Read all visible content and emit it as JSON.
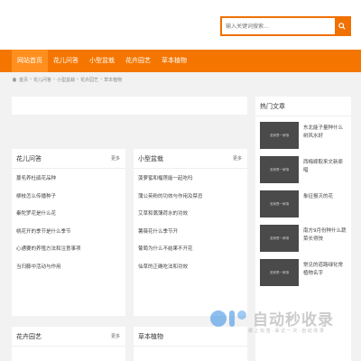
{
  "search": {
    "placeholder": "输入关键词搜索..."
  },
  "nav": {
    "items": [
      {
        "label": "网站首页"
      },
      {
        "label": "花儿问答"
      },
      {
        "label": "小型盆栽"
      },
      {
        "label": "花卉园艺"
      },
      {
        "label": "草本植物"
      }
    ]
  },
  "breadcrumb": {
    "home": "首页",
    "sep": "›",
    "c1": "花儿问答",
    "c2": "小型盆栽",
    "c3": "花卉园艺",
    "c4": "草本植物"
  },
  "panels": [
    {
      "title": "花儿问答",
      "more": "更多",
      "items": [
        "蔓毛养杜鹃花品种",
        "柳枝怎么传播种子",
        "秦陀罗花是什么花",
        "桃花开的季节是什么季节",
        "心通要的养殖方法和注意事项",
        "当归藤中活动与作用"
      ]
    },
    {
      "title": "小型盆栽",
      "more": "更多",
      "items": [
        "菠萝蜜和榴莲能一起吃吗",
        "蒲公英粉的功效与作用及禁忌",
        "艾草和蒿薄荷水的功效",
        "薯薇花什么季节开",
        "葡萄为什么不结果不开花",
        "仙草的正确吃法和功效"
      ]
    },
    {
      "title": "花卉园艺",
      "more": "更多"
    },
    {
      "title": "草本植物"
    }
  ],
  "sidebar": {
    "title": "热门文章",
    "items": [
      {
        "thumb": "宜家是一家哦",
        "text": "东北能子量种什么树风水好"
      },
      {
        "thumb": "宜家是一家哦",
        "text": "西梅嫁取来文新原唱"
      },
      {
        "thumb": "宜家是一家哦",
        "text": "象征报灭的花"
      },
      {
        "thumb": "宜家是一家哦",
        "text": "南方9月份种什么蔬菜长得快"
      },
      {
        "thumb": "宜家是一家哦",
        "text": "常见的道路绿化常植物名字"
      }
    ]
  },
  "watermark": {
    "title": "自动秒收录",
    "sub": "做 上 标 签  ·  来 访 一 次  ·  自 动 收 录"
  },
  "colors": {
    "accent": "#f47600",
    "nav_active": "#ff8f1f",
    "logo_blue": "#2f8be6"
  }
}
